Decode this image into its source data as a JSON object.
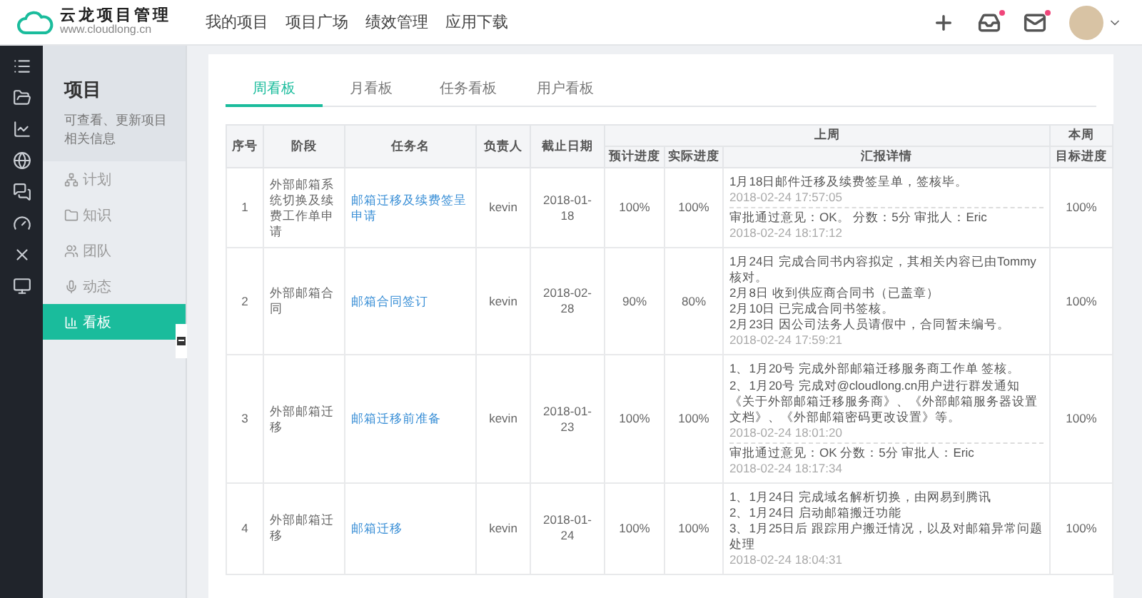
{
  "logo": {
    "name": "云龙项目管理",
    "url": "www.cloudlong.cn"
  },
  "nav": [
    {
      "label": "我的项目"
    },
    {
      "label": "项目广场"
    },
    {
      "label": "绩效管理"
    },
    {
      "label": "应用下载"
    }
  ],
  "header_icons": [
    {
      "kind": "plus",
      "dot": false
    },
    {
      "kind": "inbox",
      "dot": true
    },
    {
      "kind": "mail",
      "dot": true
    }
  ],
  "rail": [
    {
      "kind": "list"
    },
    {
      "kind": "folder"
    },
    {
      "kind": "chart"
    },
    {
      "kind": "globe"
    },
    {
      "kind": "chat"
    },
    {
      "kind": "gauge"
    },
    {
      "kind": "cross"
    },
    {
      "kind": "monitor"
    }
  ],
  "sidebar": {
    "title": "项目",
    "description": "可查看、更新项目相关信息",
    "items": [
      {
        "kind": "plan",
        "label": "计划",
        "selected": false
      },
      {
        "kind": "knowledge",
        "label": "知识",
        "selected": false
      },
      {
        "kind": "team",
        "label": "团队",
        "selected": false
      },
      {
        "kind": "activity",
        "label": "动态",
        "selected": false
      },
      {
        "kind": "board",
        "label": "看板",
        "selected": true
      }
    ]
  },
  "tabs": [
    {
      "label": "周看板",
      "selected": true
    },
    {
      "label": "月看板",
      "selected": false
    },
    {
      "label": "任务看板",
      "selected": false
    },
    {
      "label": "用户看板",
      "selected": false
    }
  ],
  "table": {
    "columns": [
      "序号",
      "阶段",
      "任务名",
      "负责人",
      "截止日期"
    ],
    "last_week": {
      "title": "上周",
      "columns": [
        "预计进度",
        "实际进度",
        "汇报详情"
      ]
    },
    "this_week": {
      "title": "本周",
      "columns": [
        "目标进度"
      ]
    },
    "rows": [
      {
        "no": "1",
        "stage": "外部邮箱系统切换及续费工作单申请",
        "task": "邮箱迁移及续费签呈申请",
        "owner": "kevin",
        "due": "2018-01-18",
        "planned": "100%",
        "actual": "100%",
        "details": [
          {
            "kind": "report",
            "lines": [
              "1月18日邮件迁移及续费签呈单，签核毕。"
            ],
            "time": "2018-02-24 17:57:05"
          },
          {
            "kind": "approval",
            "lines": [
              "审批通过意见：OK。  分数：5分  审批人：Eric"
            ],
            "time": "2018-02-24 18:17:12"
          }
        ],
        "target": "100%"
      },
      {
        "no": "2",
        "stage": "外部邮箱合同",
        "task": "邮箱合同签订",
        "owner": "kevin",
        "due": "2018-02-28",
        "planned": "90%",
        "actual": "80%",
        "details": [
          {
            "kind": "report",
            "lines": [
              "1月24日 完成合同书内容拟定，其相关内容已由Tommy核对。",
              "2月8日 收到供应商合同书（已盖章）",
              "2月10日 已完成合同书签核。",
              "2月23日 因公司法务人员请假中，合同暂未编号。"
            ],
            "time": "2018-02-24 17:59:21"
          }
        ],
        "target": "100%"
      },
      {
        "no": "3",
        "stage": "外部邮箱迁移",
        "task": "邮箱迁移前准备",
        "owner": "kevin",
        "due": "2018-01-23",
        "planned": "100%",
        "actual": "100%",
        "details": [
          {
            "kind": "report",
            "lines": [
              "1、1月20号 完成外部邮箱迁移服务商工作单 签核。",
              "2、1月20号 完成对@cloudlong.cn用户进行群发通知《关于外部邮箱迁移服务商》、《外部邮箱服务器设置文档》、《外部邮箱密码更改设置》等。"
            ],
            "time": "2018-02-24 18:01:20"
          },
          {
            "kind": "approval",
            "lines": [
              "审批通过意见：OK 分数：5分 审批人：Eric"
            ],
            "time": "2018-02-24 18:17:34"
          }
        ],
        "target": "100%"
      },
      {
        "no": "4",
        "stage": "外部邮箱迁移",
        "task": "邮箱迁移",
        "owner": "kevin",
        "due": "2018-01-24",
        "planned": "100%",
        "actual": "100%",
        "details": [
          {
            "kind": "report",
            "lines": [
              "1、1月24日 完成域名解析切换，由网易到腾讯",
              "2、1月24日 启动邮箱搬迁功能",
              "3、1月25日后 跟踪用户搬迁情况，以及对邮箱异常问题处理"
            ],
            "time": "2018-02-24 18:04:31"
          }
        ],
        "target": "100%"
      }
    ]
  }
}
